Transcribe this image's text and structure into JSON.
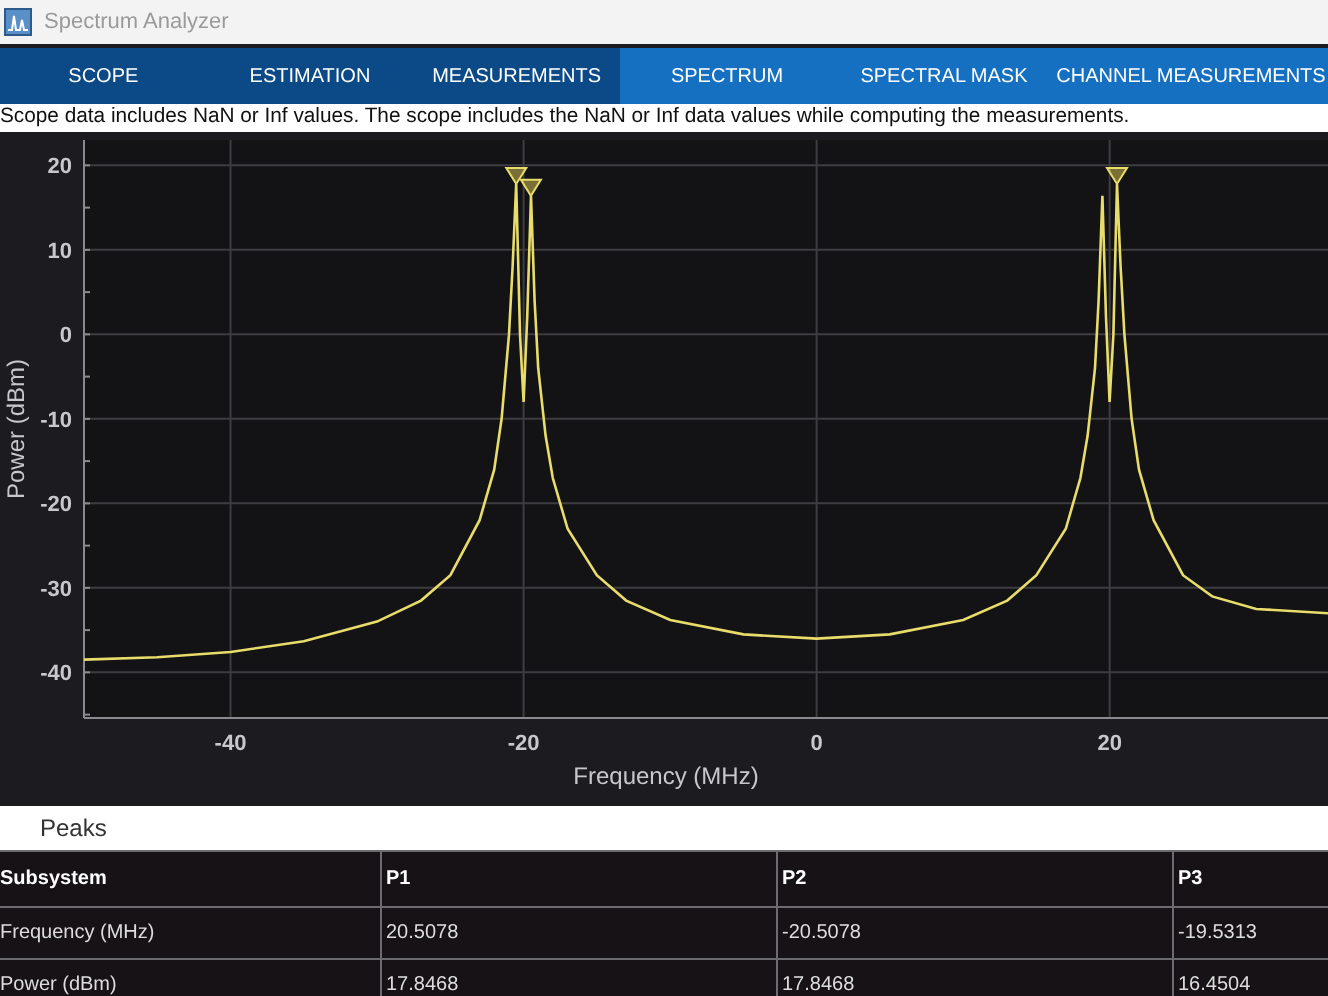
{
  "window": {
    "title": "Spectrum Analyzer"
  },
  "tab_groups": [
    {
      "color": "#0b4a86",
      "tabs": [
        {
          "label": "SCOPE"
        },
        {
          "label": "ESTIMATION"
        },
        {
          "label": "MEASUREMENTS"
        }
      ]
    },
    {
      "color": "#1670c2",
      "tabs": [
        {
          "label": "SPECTRUM"
        },
        {
          "label": "SPECTRAL MASK"
        },
        {
          "label": "CHANNEL MEASUREMENTS"
        }
      ]
    }
  ],
  "message": "Scope data includes NaN or Inf values. The scope includes the NaN or Inf data values while computing the measurements.",
  "chart_data": {
    "type": "line",
    "xlabel": "Frequency (MHz)",
    "ylabel": "Power (dBm)",
    "x": [
      -50,
      -45,
      -40,
      -35,
      -30,
      -27,
      -25,
      -23,
      -22,
      -21.5,
      -21,
      -20.75,
      -20.5,
      -20.25,
      -20,
      -19.75,
      -19.5,
      -19.25,
      -19,
      -18.5,
      -18,
      -17,
      -15,
      -13,
      -10,
      -5,
      0,
      5,
      10,
      13,
      15,
      17,
      18,
      18.5,
      19,
      19.25,
      19.5,
      19.75,
      20,
      20.25,
      20.5,
      20.75,
      21,
      21.5,
      22,
      23,
      25,
      27,
      30,
      34.9
    ],
    "series": [
      {
        "color": "#e8dc6a",
        "values": [
          -38.5,
          -38.2,
          -37.6,
          -36.3,
          -34,
          -31.5,
          -28.5,
          -22,
          -16,
          -10,
          0,
          8,
          17.8,
          0,
          -8,
          2,
          16.4,
          4,
          -4,
          -12,
          -17,
          -23,
          -28.5,
          -31.5,
          -33.8,
          -35.5,
          -36,
          -35.5,
          -33.8,
          -31.5,
          -28.5,
          -23,
          -17,
          -12,
          -4,
          4,
          16.4,
          2,
          -8,
          0,
          17.8,
          8,
          0,
          -10,
          -16,
          -22,
          -28.5,
          -31,
          -32.5,
          -33
        ]
      }
    ],
    "xlim": [
      -50,
      34.9
    ],
    "ylim": [
      -45.4,
      23
    ],
    "xticks": [
      -40,
      -20,
      0,
      20
    ],
    "yticks": [
      -40,
      -30,
      -20,
      -10,
      0,
      10,
      20
    ],
    "grid": true
  },
  "peaks": {
    "title": "Peaks",
    "columns": [
      "Subsystem",
      "P1",
      "P2",
      "P3"
    ],
    "rows": [
      [
        "Frequency (MHz)",
        "20.5078",
        "-20.5078",
        "-19.5313"
      ],
      [
        "Power (dBm)",
        "17.8468",
        "17.8468",
        "16.4504"
      ]
    ]
  }
}
